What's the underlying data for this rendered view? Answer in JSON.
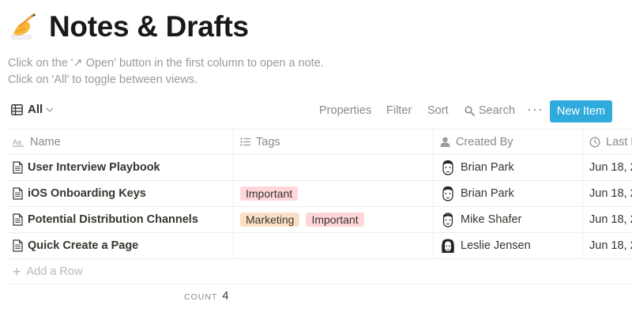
{
  "page": {
    "emoji_icon": "writing-hand-emoji",
    "title": "Notes & Drafts",
    "description_line1": "Click on the '↗ Open' button in the first column to open a note.",
    "description_line2": "Click on 'All' to toggle between views."
  },
  "toolbar": {
    "view_label": "All",
    "properties_label": "Properties",
    "filter_label": "Filter",
    "sort_label": "Sort",
    "search_label": "Search",
    "more_label": "···",
    "new_item_label": "New Item",
    "new_item_color": "#2eaadc"
  },
  "table": {
    "columns": [
      {
        "label": "Name",
        "icon": "text-property-icon"
      },
      {
        "label": "Tags",
        "icon": "list-property-icon"
      },
      {
        "label": "Created By",
        "icon": "person-property-icon"
      },
      {
        "label": "Last E",
        "icon": "clock-property-icon"
      }
    ],
    "rows": [
      {
        "name": "User Interview Playbook",
        "tags": [],
        "creator": "Brian Park",
        "date": "Jun 18, 2"
      },
      {
        "name": "iOS Onboarding Keys",
        "tags": [
          "Important"
        ],
        "creator": "Brian Park",
        "date": "Jun 18, 2"
      },
      {
        "name": "Potential Distribution Channels",
        "tags": [
          "Marketing",
          "Important"
        ],
        "creator": "Mike Shafer",
        "date": "Jun 18, 2"
      },
      {
        "name": "Quick Create a Page",
        "tags": [],
        "creator": "Leslie Jensen",
        "date": "Jun 18, 2"
      }
    ],
    "tag_colors": {
      "Important": "#ffd7db",
      "Marketing": "#fce0c6"
    },
    "add_row_label": "Add a Row"
  },
  "footer": {
    "count_label": "COUNT",
    "count_value": "4"
  }
}
